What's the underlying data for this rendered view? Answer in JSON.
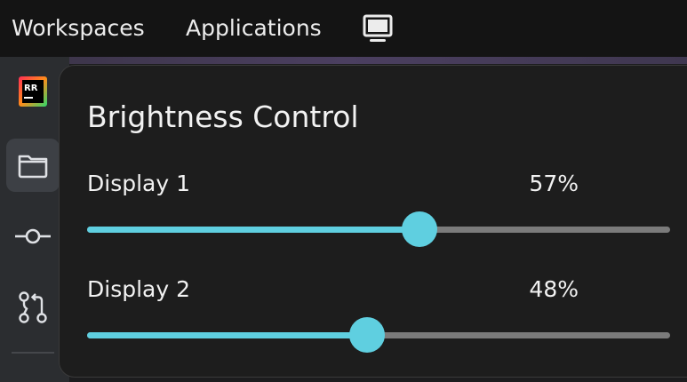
{
  "topbar": {
    "workspaces_label": "Workspaces",
    "applications_label": "Applications",
    "monitor_icon": "monitor-icon"
  },
  "sidebar": {
    "logo": "RR",
    "items": [
      {
        "icon": "folder-icon",
        "active": true
      },
      {
        "icon": "commit-icon",
        "active": false
      },
      {
        "icon": "pull-request-icon",
        "active": false
      }
    ]
  },
  "brightness": {
    "title": "Brightness Control",
    "displays": [
      {
        "label": "Display 1",
        "value_text": "57%",
        "level": 0.57
      },
      {
        "label": "Display 2",
        "value_text": "48%",
        "level": 0.48
      }
    ]
  },
  "colors": {
    "accent": "#5fcfe0",
    "track": "#7b7b7b",
    "panel_bg": "#1d1d1d"
  }
}
